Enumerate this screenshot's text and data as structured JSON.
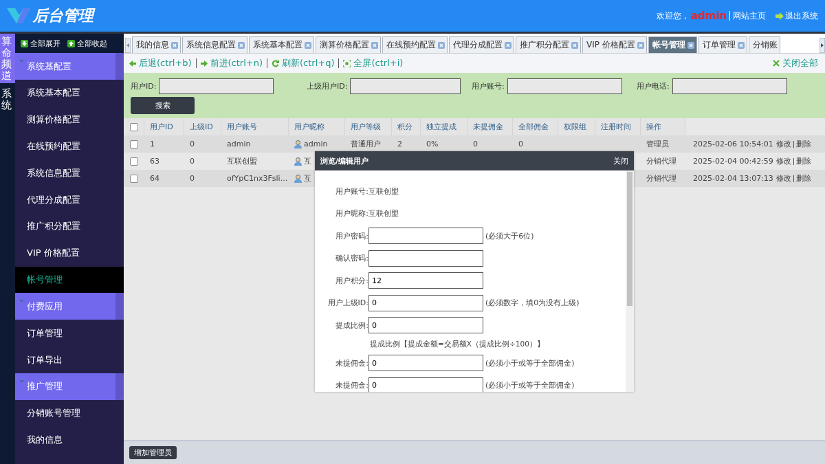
{
  "header": {
    "logo": "后台管理",
    "welcome": "欢迎您，",
    "user": "admin",
    "home_link": "网站主页",
    "logout": "退出系统"
  },
  "channels": [
    {
      "label": "算命频道",
      "selected": true
    },
    {
      "label": "系统",
      "selected": false
    }
  ],
  "sidebar": {
    "expand_all": "全部展开",
    "collapse_all": "全部收起",
    "groups": [
      {
        "title": "系统基配置",
        "expanded": true,
        "items": [
          {
            "label": "系统基本配置",
            "selected": false
          },
          {
            "label": "测算价格配置",
            "selected": false
          },
          {
            "label": "在线预约配置",
            "selected": false
          },
          {
            "label": "系统信息配置",
            "selected": false
          },
          {
            "label": "代理分成配置",
            "selected": false
          },
          {
            "label": "推广积分配置",
            "selected": false
          },
          {
            "label": "VIP 价格配置",
            "selected": false
          },
          {
            "label": "帐号管理",
            "selected": true
          }
        ]
      },
      {
        "title": "付费应用",
        "expanded": true,
        "items": [
          {
            "label": "订单管理",
            "selected": false
          },
          {
            "label": "订单导出",
            "selected": false
          }
        ]
      },
      {
        "title": "推广管理",
        "expanded": true,
        "items": [
          {
            "label": "分销账号管理",
            "selected": false
          },
          {
            "label": "我的信息",
            "selected": false
          }
        ]
      }
    ]
  },
  "tabs": [
    {
      "label": "我的信息",
      "selected": false
    },
    {
      "label": "系统信息配置",
      "selected": false
    },
    {
      "label": "系统基本配置",
      "selected": false
    },
    {
      "label": "测算价格配置",
      "selected": false
    },
    {
      "label": "在线预约配置",
      "selected": false
    },
    {
      "label": "代理分成配置",
      "selected": false
    },
    {
      "label": "推广积分配置",
      "selected": false
    },
    {
      "label": "VIP 价格配置",
      "selected": false
    },
    {
      "label": "帐号管理",
      "selected": true
    },
    {
      "label": "订单管理",
      "selected": false
    },
    {
      "label": "分销账",
      "selected": false
    }
  ],
  "toolbar": {
    "back": "后退(ctrl+b)",
    "forward": "前进(ctrl+n)",
    "refresh": "刷新(ctrl+q)",
    "fullscreen": "全屏(ctrl+i)",
    "close_all": "关闭全部"
  },
  "search": {
    "fields": [
      {
        "label": "用户ID:"
      },
      {
        "label": "上级用户ID:"
      },
      {
        "label": "用户账号:"
      },
      {
        "label": "用户电话:"
      }
    ],
    "button": "搜索"
  },
  "table": {
    "all_checked": false,
    "columns": [
      "用户ID",
      "上级ID",
      "用户账号",
      "用户昵称",
      "用户等级",
      "积分",
      "独立提成",
      "未提佣金",
      "全部佣金",
      "权限组",
      "注册时间",
      "操作"
    ],
    "rows": [
      {
        "checked": false,
        "cells": [
          "1",
          "0",
          "admin",
          "admin",
          "普通用户",
          "2",
          "0%",
          "0",
          "0"
        ],
        "role": "管理员",
        "registered": "2025-02-06 10:54:01",
        "edit": "修改",
        "delete": "删除"
      },
      {
        "checked": false,
        "cells": [
          "63",
          "0",
          "互联创盟",
          "互"
        ],
        "role": "分销代理",
        "registered": "2025-02-04 00:42:59",
        "edit": "修改",
        "delete": "删除"
      },
      {
        "checked": false,
        "cells": [
          "64",
          "0",
          "ofYpC1nx3Fsli...",
          "互"
        ],
        "role": "分销代理",
        "registered": "2025-02-04 13:07:13",
        "edit": "修改",
        "delete": "删除"
      }
    ]
  },
  "dialog": {
    "title": "浏览/编辑用户",
    "close": "关闭",
    "fields": [
      {
        "kind": "text",
        "label": "用户账号:",
        "value": "互联创盟"
      },
      {
        "kind": "text",
        "label": "用户昵称:",
        "value": "互联创盟"
      },
      {
        "kind": "input",
        "label": "用户密码:",
        "hint": "(必须大于6位)"
      },
      {
        "kind": "input",
        "label": "确认密码:"
      },
      {
        "kind": "input",
        "label": "用户积分:",
        "value": "12"
      },
      {
        "kind": "input",
        "label": "用户上级ID:",
        "value": "0",
        "hint": "(必须数字，填0为没有上级)"
      },
      {
        "kind": "input",
        "label": "提成比例:",
        "value": "0"
      },
      {
        "kind": "note",
        "value": "提成比例【提成金额=交易额X（提成比例÷100）】"
      },
      {
        "kind": "input",
        "label": "未提佣金:",
        "value": "0",
        "hint": "(必须小于或等于全部佣金)"
      },
      {
        "kind": "input",
        "label": "未提佣金:",
        "value": "0",
        "hint": "(必须小于或等于全部佣金)"
      }
    ]
  },
  "footer": {
    "button": "增加管理员"
  }
}
